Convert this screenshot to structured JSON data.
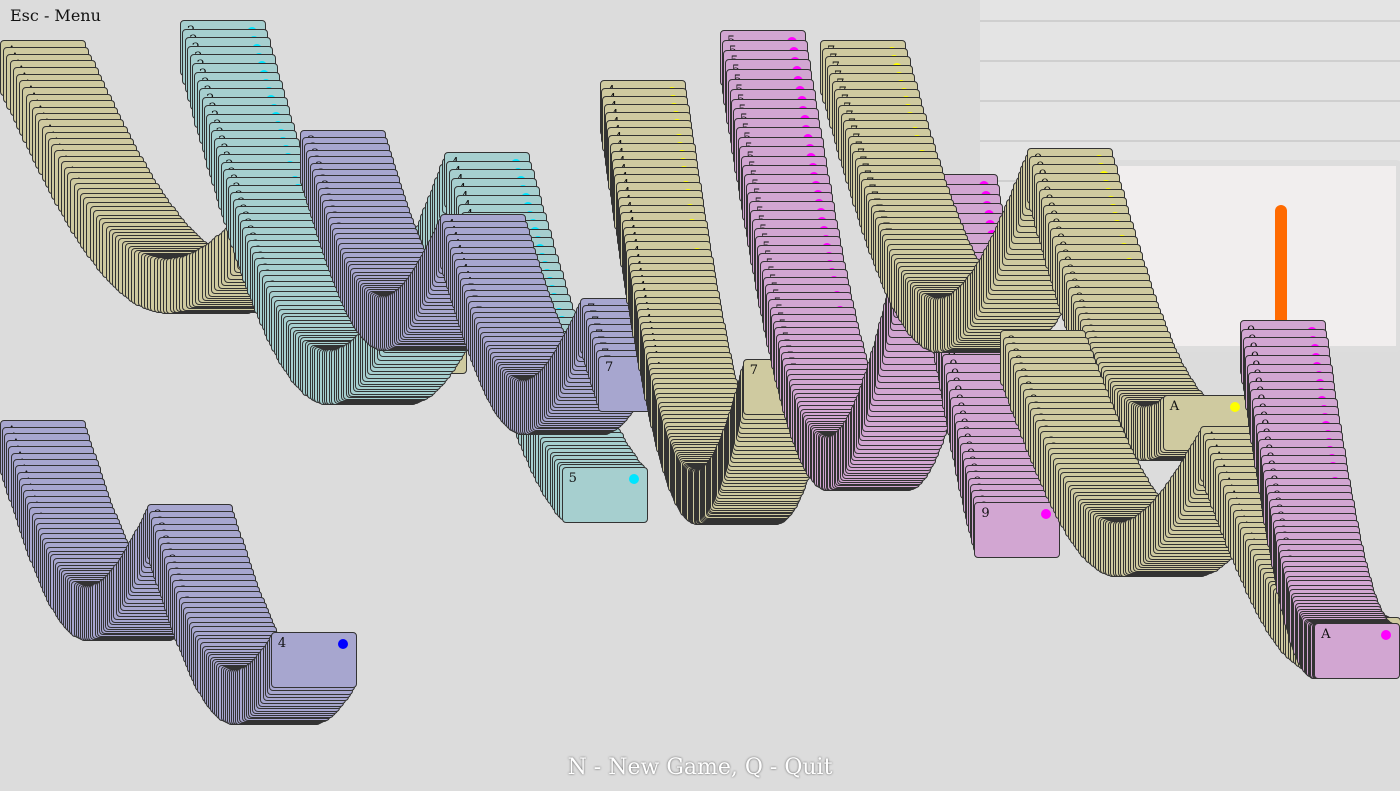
{
  "hud": {
    "menu_hint": "Esc - Menu",
    "footer_hint": "N - New Game, Q - Quit"
  },
  "palette": {
    "background": "#dcdcdc",
    "cards": [
      "#a6cfcf",
      "#a7a6cf",
      "#cfcaa0",
      "#d2a6d2"
    ],
    "pips": [
      "#00e5ff",
      "#0000ff",
      "#ffff00",
      "#ff00ff"
    ],
    "cabinet_handle": "#ff6a00"
  },
  "cascade_ranks": [
    "A",
    "2",
    "3",
    "4",
    "5",
    "7",
    "8",
    "9"
  ]
}
